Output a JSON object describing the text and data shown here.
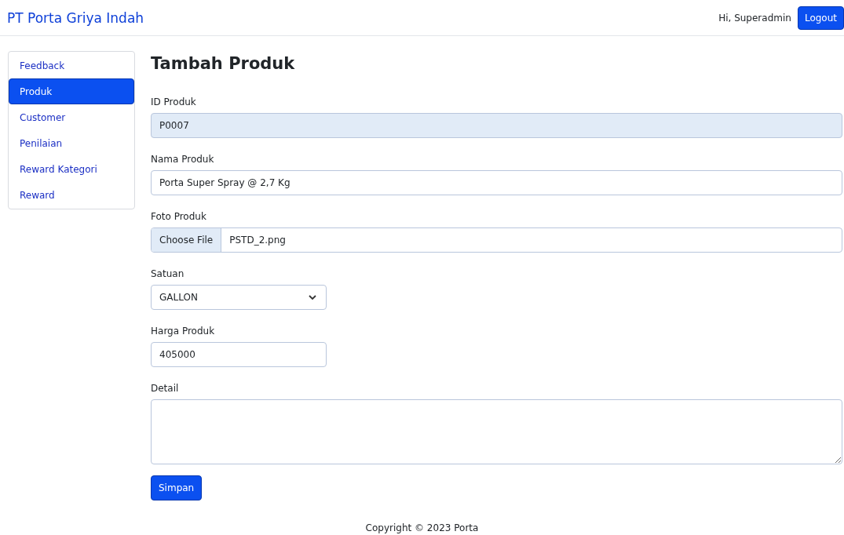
{
  "brand": "PT Porta Griya Indah",
  "user": {
    "greeting": "Hi, Superadmin",
    "logout": "Logout"
  },
  "sidebar": {
    "items": [
      {
        "label": "Feedback",
        "selected": false
      },
      {
        "label": "Produk",
        "selected": true
      },
      {
        "label": "Customer",
        "selected": false
      },
      {
        "label": "Penilaian",
        "selected": false
      },
      {
        "label": "Reward Kategori",
        "selected": false
      },
      {
        "label": "Reward",
        "selected": false
      }
    ]
  },
  "form": {
    "title": "Tambah Produk",
    "fields": [
      {
        "kind": "text",
        "label": "ID Produk",
        "value": "P0007",
        "disabled": true
      },
      {
        "kind": "text",
        "label": "Nama Produk",
        "value": "Porta Super Spray @ 2,7 Kg",
        "disabled": false
      },
      {
        "kind": "file",
        "label": "Foto Produk",
        "button": "Choose File",
        "value": "PSTD_2.png"
      },
      {
        "kind": "select",
        "label": "Satuan",
        "value": "GALLON"
      },
      {
        "kind": "number",
        "label": "Harga Produk",
        "value": "405000",
        "disabled": false
      },
      {
        "kind": "textarea",
        "label": "Detail"
      }
    ],
    "submit": "Simpan"
  },
  "footer": "Copyright © 2023 Porta"
}
